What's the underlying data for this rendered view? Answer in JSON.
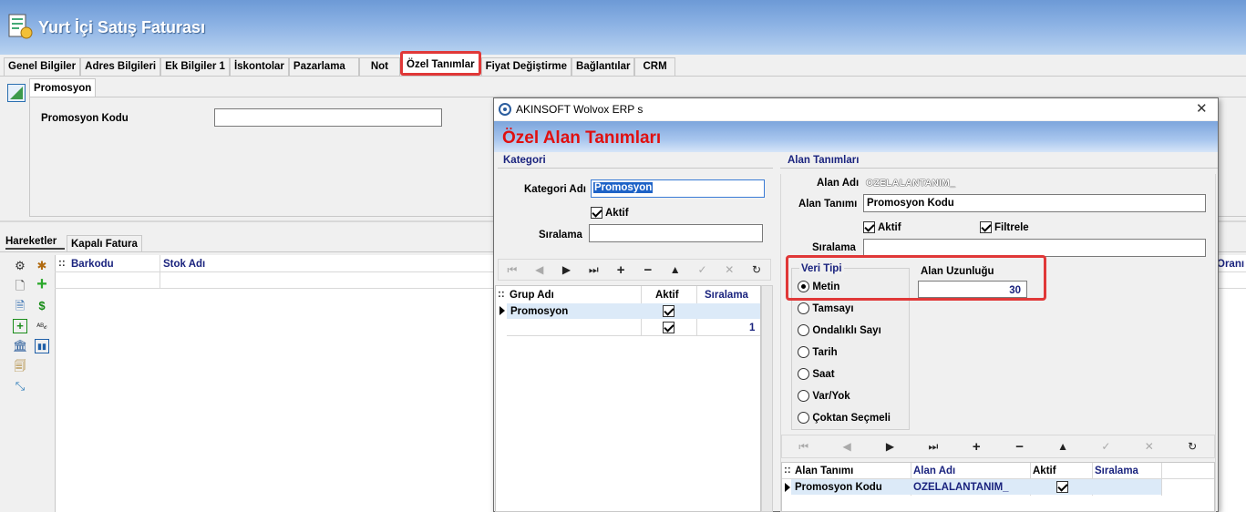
{
  "window": {
    "title": "Yurt İçi Satış Faturası"
  },
  "main_tabs": [
    {
      "label": "Genel Bilgiler"
    },
    {
      "label": "Adres Bilgileri"
    },
    {
      "label": "Ek Bilgiler 1"
    },
    {
      "label": "İskontolar"
    },
    {
      "label": "Pazarlama"
    },
    {
      "label": "Not"
    },
    {
      "label": "Özel Tanımlar"
    },
    {
      "label": "Fiyat Değiştirme"
    },
    {
      "label": "Bağlantılar"
    },
    {
      "label": "CRM"
    }
  ],
  "sub_tab": {
    "label": "Promosyon"
  },
  "promosyon": {
    "field_label": "Promosyon Kodu",
    "field_value": ""
  },
  "lower_tabs": [
    {
      "label": "Hareketler"
    },
    {
      "label": "Kapalı Fatura"
    }
  ],
  "lines_grid": {
    "columns": [
      "Barkodu",
      "Stok Adı"
    ],
    "right_header": "Oranı"
  },
  "dialog": {
    "caption": "AKINSOFT Wolvox ERP s",
    "close_glyph": "✕",
    "header": "Özel Alan Tanımları",
    "kategori": {
      "section_title": "Kategori",
      "kategori_adi_label": "Kategori Adı",
      "kategori_adi_value": "Promosyon",
      "aktif_label": "Aktif",
      "aktif_checked": true,
      "siralama_label": "Sıralama",
      "siralama_value": "",
      "nav": [
        "⏮",
        "◀",
        "▶",
        "⏭",
        "+",
        "−",
        "▲",
        "✓",
        "✕",
        "↻"
      ],
      "grid": {
        "columns": [
          "Grup Adı",
          "Aktif",
          "Sıralama"
        ],
        "rows": [
          {
            "name": "Promosyon",
            "aktif": true,
            "siralama": ""
          },
          {
            "name": "",
            "aktif": true,
            "siralama": "1"
          }
        ]
      }
    },
    "alan": {
      "section_title": "Alan Tanımları",
      "alan_adi_label": "Alan Adı",
      "alan_adi_value": "OZELALANTANIM_",
      "alan_tanimi_label": "Alan Tanımı",
      "alan_tanimi_value": "Promosyon Kodu",
      "aktif_label": "Aktif",
      "filtrele_label": "Filtrele",
      "siralama_label": "Sıralama",
      "siralama_value": "",
      "veri_tipi_title": "Veri Tipi",
      "veri_tipi_options": [
        "Metin",
        "Tamsayı",
        "Ondalıklı Sayı",
        "Tarih",
        "Saat",
        "Var/Yok",
        "Çoktan Seçmeli"
      ],
      "veri_tipi_selected": "Metin",
      "alan_uzunlugu_label": "Alan Uzunluğu",
      "alan_uzunlugu_value": "30",
      "nav": [
        "⏮",
        "◀",
        "▶",
        "⏭",
        "+",
        "−",
        "▲",
        "✓",
        "✕",
        "↻"
      ],
      "grid": {
        "columns": [
          "Alan Tanımı",
          "Alan Adı",
          "Aktif",
          "Sıralama"
        ],
        "rows": [
          {
            "alan_tanimi": "Promosyon Kodu",
            "alan_adi": "OZELALANTANIM_",
            "aktif": true,
            "siralama": ""
          }
        ]
      }
    }
  },
  "colors": {
    "highlight": "#e03838",
    "header_red": "#e01010",
    "header_blue": "#1a237e",
    "title_gradient": "#6d9ad6"
  }
}
